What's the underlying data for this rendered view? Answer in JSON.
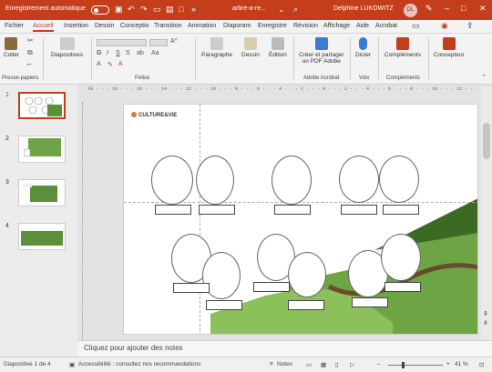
{
  "titlebar": {
    "autosave": "Enregistrement automatique",
    "filename": "arbre-a-re...",
    "user": "Delphine LUKOWITZ",
    "initials": "DL"
  },
  "tabs": [
    "Fichier",
    "Accueil",
    "Insertion",
    "Dessin",
    "Conceptio",
    "Transition",
    "Animation",
    "Diaporam",
    "Enregistre",
    "Révision",
    "Affichage",
    "Aide",
    "Acrobat"
  ],
  "ribbon": {
    "coller": "Coller",
    "presse": "Presse-papiers",
    "diapositives": "Diapositives",
    "police": "Police",
    "paragraphe": "Paragraphe",
    "dessin": "Dessin",
    "edition": "Édition",
    "creer_pdf_1": "Créer et partager",
    "creer_pdf_2": "un PDF Adobe",
    "adobe": "Adobe Acrobat",
    "dicter": "Dicter",
    "voix": "Voix",
    "complements": "Compléments",
    "complements_grp": "Compléments",
    "concepteur": "Concepteur"
  },
  "thumbs": [
    "1",
    "2",
    "3",
    "4"
  ],
  "ruler_text": "20 · · · 18 · · · 16 · · · 14 · · · 12 · · · 10 · · · 8 · · · 6 · · · 4 · · · 2 · · · 0 · · · 2 · · · 4 · · · 6 · · · 8 · · · 10 · · · 12 · · · 14 · · · 16 · · · 18 · · · 20",
  "slide": {
    "logo": "CULTURE&VIE"
  },
  "notes_placeholder": "Cliquez pour ajouter des notes",
  "status": {
    "slide": "Diapositive 1 de 4",
    "accessibility": "Accessibilité : consultez nos recommandations",
    "notes": "Notes",
    "zoom": "41 %"
  },
  "colors": {
    "accent": "#c43e1c"
  }
}
